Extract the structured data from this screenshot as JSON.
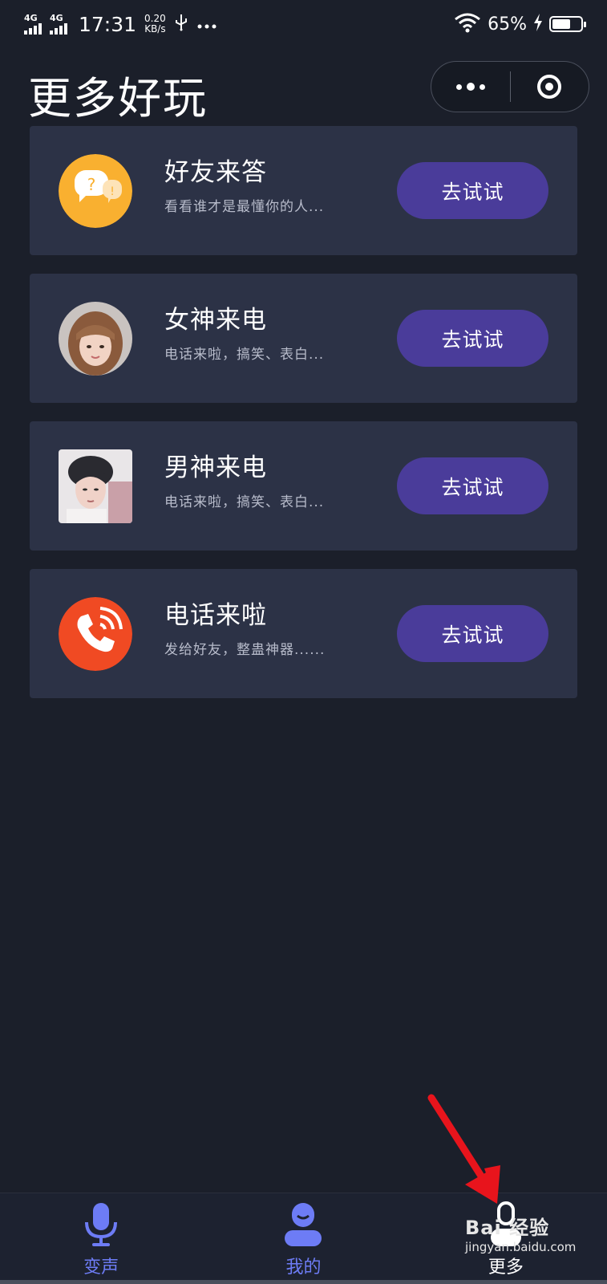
{
  "status_bar": {
    "network1": "4G",
    "network2": "4G",
    "time": "17:31",
    "speed_value": "0.20",
    "speed_unit": "KB/s",
    "battery_percent": "65%",
    "battery_level": 0.65
  },
  "header": {
    "title": "更多好玩"
  },
  "cards": [
    {
      "title": "好友来答",
      "desc": "看看谁才是最懂你的人...",
      "button": "去试试",
      "icon": "question-bubbles-icon"
    },
    {
      "title": "女神来电",
      "desc": "电话来啦，搞笑、表白...",
      "button": "去试试",
      "icon": "girl-avatar"
    },
    {
      "title": "男神来电",
      "desc": "电话来啦，搞笑、表白...",
      "button": "去试试",
      "icon": "boy-avatar"
    },
    {
      "title": "电话来啦",
      "desc": "发给好友，整蛊神器......",
      "button": "去试试",
      "icon": "phone-ringing-icon"
    }
  ],
  "tab_bar": {
    "tabs": [
      {
        "label": "变声",
        "icon": "microphone-icon"
      },
      {
        "label": "我的",
        "icon": "user-icon"
      },
      {
        "label": "更多",
        "icon": "more-icon"
      }
    ]
  },
  "watermark": {
    "brand": "Bai 经验",
    "url": "jingyan.baidu.com"
  },
  "colors": {
    "background": "#1b1f2a",
    "card": "#2c3246",
    "button": "#4a3c9a",
    "tab_active": "#6d7cf5"
  }
}
